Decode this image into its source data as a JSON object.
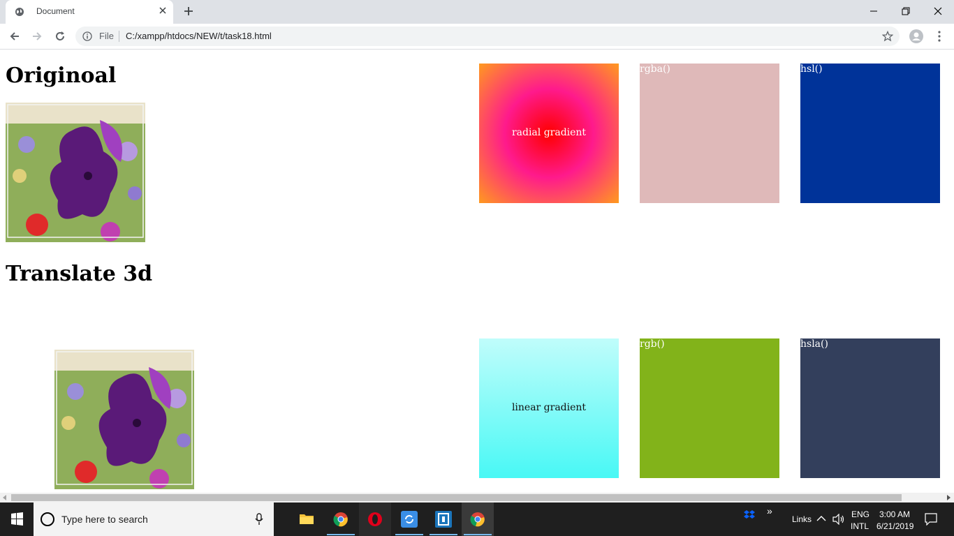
{
  "browser": {
    "tab_title": "Document",
    "address_scheme": "File",
    "address_url": "C:/xampp/htdocs/NEW/t/task18.html"
  },
  "page": {
    "heading_original": "Originoal",
    "heading_translate": "Translate 3d",
    "boxes": {
      "radial": {
        "text": "radial gradient"
      },
      "rgba": {
        "label": "rgba()",
        "color": "#dfb9b9"
      },
      "hsl": {
        "label": "hsl()",
        "color": "#003399"
      },
      "linear": {
        "text": "linear gradient"
      },
      "rgb": {
        "label": "rgb()",
        "color": "#82b31a"
      },
      "hsla": {
        "label": "hsla()",
        "color": "#333f5c"
      }
    }
  },
  "taskbar": {
    "search_placeholder": "Type here to search",
    "links_label": "Links",
    "lang_line1": "ENG",
    "lang_line2": "INTL",
    "time": "3:00 AM",
    "date": "6/21/2019"
  }
}
